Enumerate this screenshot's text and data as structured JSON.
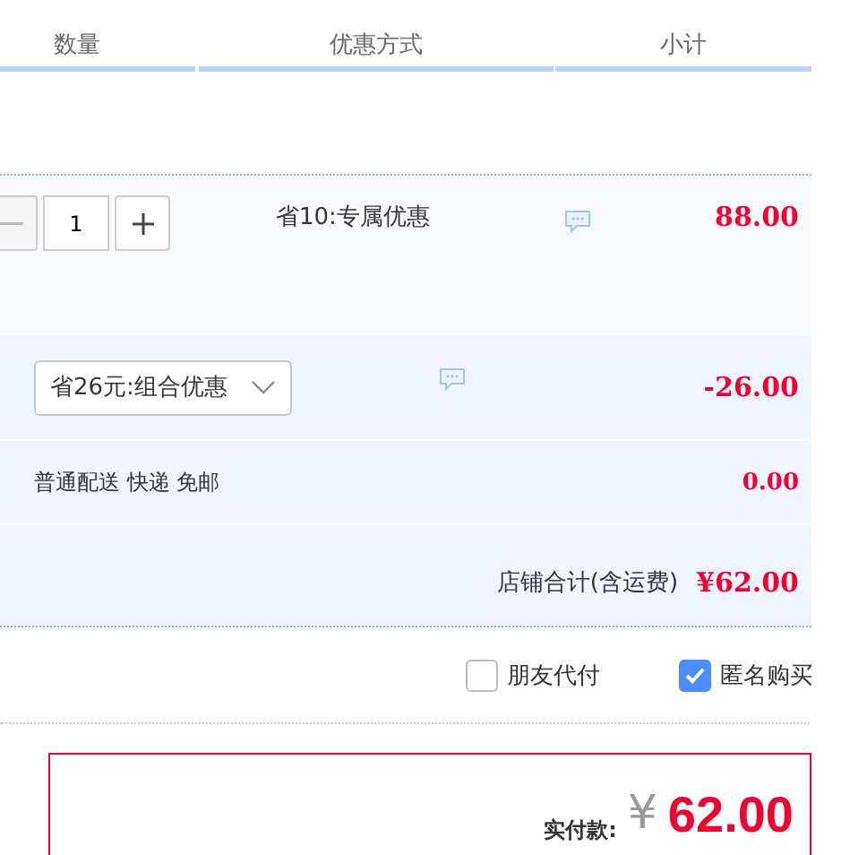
{
  "table": {
    "columns": [
      "数量",
      "优惠方式",
      "小计"
    ]
  },
  "item": {
    "quantity": "1",
    "promotion": "省10:专属优惠",
    "subtotal": "88.00"
  },
  "discount": {
    "selected_option": "省26元:组合优惠",
    "amount": "-26.00"
  },
  "shipping": {
    "method": "普通配送 快递 免邮",
    "fee": "0.00"
  },
  "shop_total": {
    "label": "店铺合计(含运费)",
    "amount": "¥62.00"
  },
  "options": [
    {
      "label": "朋友代付",
      "checked": false
    },
    {
      "label": "匿名购买",
      "checked": true
    }
  ],
  "payment": {
    "label": "实付款:",
    "currency": "¥",
    "amount": "62.00"
  }
}
